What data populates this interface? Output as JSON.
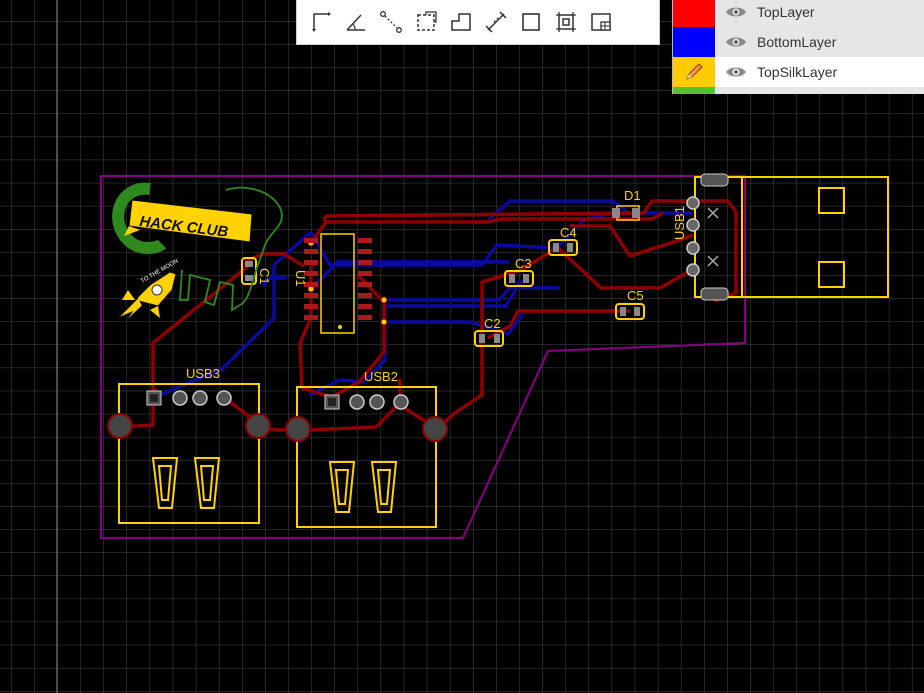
{
  "toolbar": {
    "tools": [
      {
        "name": "track-tool-icon"
      },
      {
        "name": "angle-tool-icon"
      },
      {
        "name": "connect-pad-tool-icon"
      },
      {
        "name": "dashed-rectangle-tool-icon"
      },
      {
        "name": "solid-region-tool-icon"
      },
      {
        "name": "dimension-tool-icon"
      },
      {
        "name": "rectangle-tool-icon"
      },
      {
        "name": "group-select-tool-icon"
      },
      {
        "name": "image-tool-icon"
      }
    ]
  },
  "layers": [
    {
      "name": "TopLayer",
      "color": "#ff0000",
      "visible": true,
      "active": false
    },
    {
      "name": "BottomLayer",
      "color": "#0000ff",
      "visible": true,
      "active": false
    },
    {
      "name": "TopSilkLayer",
      "color": "#ffcc00",
      "visible": true,
      "active": true
    }
  ],
  "colors": {
    "background": "#000000",
    "grid": "#3a3a3a",
    "top_copper": "#8b0000",
    "bottom_copper": "#0a0aa0",
    "silkscreen": "#ffd200",
    "board_outline": "#800080"
  },
  "components": {
    "usb3_label": "USB3",
    "usb2_label": "USB2",
    "usb1_label": "USB1",
    "d1_label": "D1",
    "c2_label": "C2",
    "c3_label": "C3",
    "c4_label": "C4",
    "c5_label": "C5",
    "c1_label": "C1",
    "u1_label": "U1"
  },
  "logo": {
    "banner_text": "HACK CLUB",
    "rocket_text": "TO THE MOON"
  }
}
